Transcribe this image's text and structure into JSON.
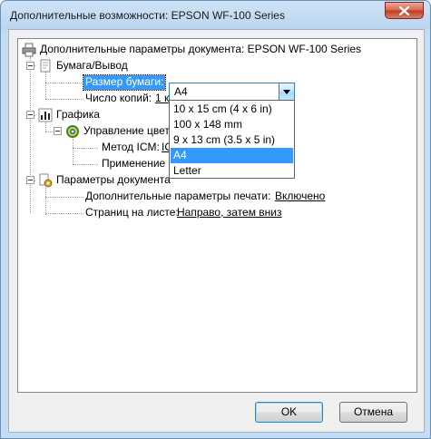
{
  "window": {
    "title": "Дополнительные возможности: EPSON WF-100 Series"
  },
  "tree": {
    "root_label": "Дополнительные параметры документа: EPSON WF-100 Series",
    "paper_output": {
      "label": "Бумага/Вывод",
      "paper_size_label": "Размер бумаги:",
      "paper_size_value": "A4",
      "copies_label": "Число копий:",
      "copies_value": "1 к"
    },
    "graphics": {
      "label": "Графика",
      "color_mgmt_label": "Управление цвет",
      "icm_method_label": "Метод ICM:",
      "icm_method_value": "IC",
      "apply_label": "Применение"
    },
    "document_params": {
      "label": "Параметры документа",
      "advanced_print_label": "Дополнительные параметры печати:",
      "advanced_print_value": "Включено",
      "pages_per_sheet_label": "Страниц на листе:",
      "pages_per_sheet_value": "Направо, затем вниз"
    }
  },
  "dropdown": {
    "options": [
      "10 x 15 cm (4 x 6 in)",
      "100 x 148 mm",
      "9 x 13 cm (3.5 x 5 in)",
      "A4",
      "Letter"
    ],
    "selected": "A4"
  },
  "buttons": {
    "ok": "OK",
    "cancel": "Отмена"
  },
  "colors": {
    "selection": "#3399ff",
    "title_bar": "#c6dcf2",
    "close_button": "#c23c22"
  }
}
